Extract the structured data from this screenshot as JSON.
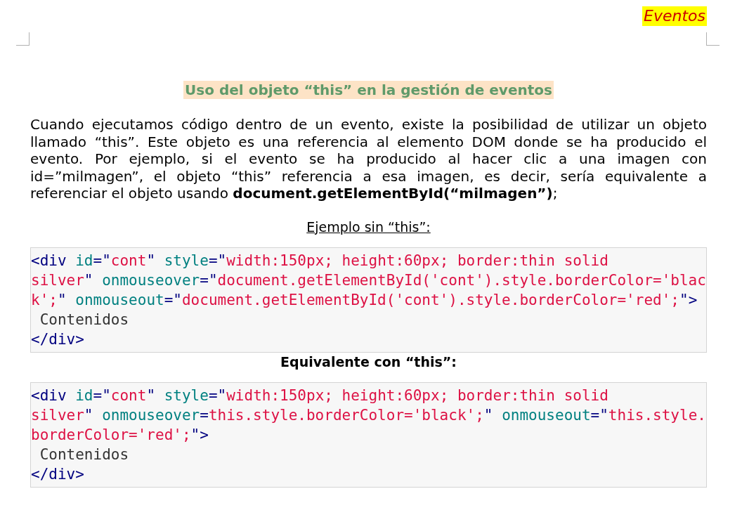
{
  "header": {
    "text": "Eventos"
  },
  "title": "Uso del objeto “this” en la gestión de eventos",
  "paragraph": "Cuando ejecutamos código dentro de un evento, existe la posibilidad de utilizar un objeto llamado “this”. Este objeto es una referencia al elemento DOM donde se ha producido el evento. Por ejemplo, si el evento se ha producido al hacer clic a una imagen con id=”milmagen”, el objeto “this” referencia a esa imagen, es decir, sería equivalente a referenciar el objeto usando **document.getElementById(“milmagen”)**;",
  "sections": [
    {
      "heading": "Ejemplo sin “this”:",
      "kind": "underlined",
      "code_lines": [
        [
          {
            "kind": "tag",
            "text": "<div"
          },
          {
            "kind": "attr",
            "text": " id"
          },
          {
            "kind": "punct",
            "text": "=\""
          },
          {
            "kind": "value",
            "text": "cont"
          },
          {
            "kind": "punct",
            "text": "\" "
          },
          {
            "kind": "attr",
            "text": "style"
          },
          {
            "kind": "punct",
            "text": "=\""
          },
          {
            "kind": "value",
            "text": "width:150px; height:60px; border:thin solid"
          }
        ],
        [
          {
            "kind": "value",
            "text": "silver"
          },
          {
            "kind": "punct",
            "text": "\" "
          },
          {
            "kind": "attr",
            "text": "onmouseover"
          },
          {
            "kind": "punct",
            "text": "=\""
          },
          {
            "kind": "value",
            "text": "document.getElementById('cont').style.borderColor='blac"
          }
        ],
        [
          {
            "kind": "value",
            "text": "k';"
          },
          {
            "kind": "punct",
            "text": "\" "
          },
          {
            "kind": "attr",
            "text": "onmouseout"
          },
          {
            "kind": "punct",
            "text": "=\""
          },
          {
            "kind": "value",
            "text": "document.getElementById('cont').style.borderColor='red';"
          },
          {
            "kind": "punct",
            "text": "\""
          },
          {
            "kind": "tag",
            "text": ">"
          }
        ],
        [
          {
            "kind": "plain",
            "text": " Contenidos"
          }
        ],
        [
          {
            "kind": "tag",
            "text": "</div>"
          }
        ]
      ]
    },
    {
      "heading": "Equivalente con “this”:",
      "kind": "bold",
      "code_lines": [
        [
          {
            "kind": "tag",
            "text": "<div"
          },
          {
            "kind": "attr",
            "text": " id"
          },
          {
            "kind": "punct",
            "text": "=\""
          },
          {
            "kind": "value",
            "text": "cont"
          },
          {
            "kind": "punct",
            "text": "\" "
          },
          {
            "kind": "attr",
            "text": "style"
          },
          {
            "kind": "punct",
            "text": "=\""
          },
          {
            "kind": "value",
            "text": "width:150px; height:60px; border:thin solid"
          }
        ],
        [
          {
            "kind": "value",
            "text": "silver"
          },
          {
            "kind": "punct",
            "text": "\" "
          },
          {
            "kind": "attr",
            "text": "onmouseover"
          },
          {
            "kind": "punct",
            "text": "="
          },
          {
            "kind": "value",
            "text": "this.style.borderColor='black';"
          },
          {
            "kind": "punct",
            "text": "\" "
          },
          {
            "kind": "attr",
            "text": "onmouseout"
          },
          {
            "kind": "punct",
            "text": "=\""
          },
          {
            "kind": "value",
            "text": "this.style."
          }
        ],
        [
          {
            "kind": "value",
            "text": "borderColor='red';"
          },
          {
            "kind": "punct",
            "text": "\""
          },
          {
            "kind": "tag",
            "text": ">"
          }
        ],
        [
          {
            "kind": "plain",
            "text": " Contenidos"
          }
        ],
        [
          {
            "kind": "tag",
            "text": "</div>"
          }
        ]
      ]
    }
  ]
}
